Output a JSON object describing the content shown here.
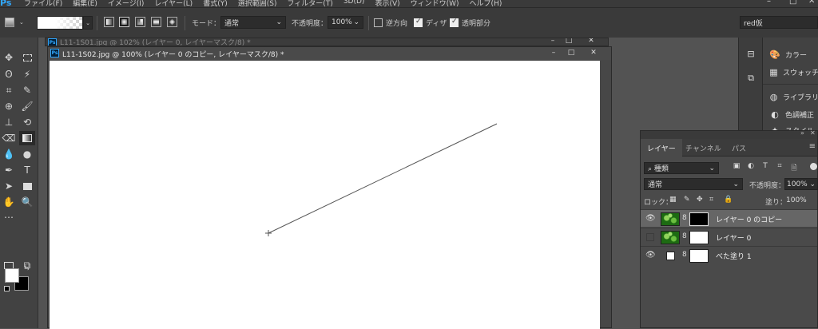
{
  "app": {
    "logo": "Ps"
  },
  "menu": [
    "ファイル(F)",
    "編集(E)",
    "イメージ(I)",
    "レイヤー(L)",
    "書式(Y)",
    "選択範囲(S)",
    "フィルター(T)",
    "3D(D)",
    "表示(V)",
    "ウィンドウ(W)",
    "ヘルプ(H)"
  ],
  "options": {
    "mode_label": "モード：",
    "mode_value": "通常",
    "opacity_label": "不透明度：",
    "opacity_value": "100%",
    "reverse_label": "逆方向",
    "reverse_checked": false,
    "dither_label": "ディザ",
    "dither_checked": true,
    "transparency_label": "透明部分",
    "transparency_checked": true
  },
  "search": {
    "value": "red仮"
  },
  "documents": {
    "back_title": "L11-1S01.jpg @ 102% (レイヤー 0, レイヤーマスク/8) *",
    "active_title": "L11-1S02.jpg @ 100% (レイヤー 0 のコピー, レイヤーマスク/8) *"
  },
  "window_controls": {
    "min": "–",
    "max": "□",
    "close": "✕"
  },
  "dock": {
    "items": [
      {
        "label": "カラー",
        "icon": "palette-icon"
      },
      {
        "label": "スウォッチ",
        "icon": "grid-icon"
      },
      {
        "label": "ライブラリ",
        "icon": "library-icon"
      },
      {
        "label": "色調補正",
        "icon": "adjust-icon"
      },
      {
        "label": "スタイル",
        "icon": "style-icon"
      }
    ]
  },
  "layers_panel": {
    "tabs": [
      "レイヤー",
      "チャンネル",
      "パス"
    ],
    "active_tab": 0,
    "filter_kind": "種類",
    "blend_mode": "通常",
    "opacity_label": "不透明度：",
    "opacity_value": "100%",
    "lock_label": "ロック：",
    "fill_label": "塗り：",
    "fill_value": "100%",
    "layers": [
      {
        "name": "レイヤー 0 のコピー",
        "visible": true,
        "selected": true,
        "thumb": "photo",
        "mask": "black"
      },
      {
        "name": "レイヤー 0",
        "visible": false,
        "selected": false,
        "thumb": "photo",
        "mask": "white"
      },
      {
        "name": "べた塗り 1",
        "visible": true,
        "selected": false,
        "thumb": "fill",
        "mask": "white"
      }
    ]
  },
  "colors": {
    "foreground": "#ffffff",
    "background": "#000000",
    "accent": "#31a8ff"
  }
}
